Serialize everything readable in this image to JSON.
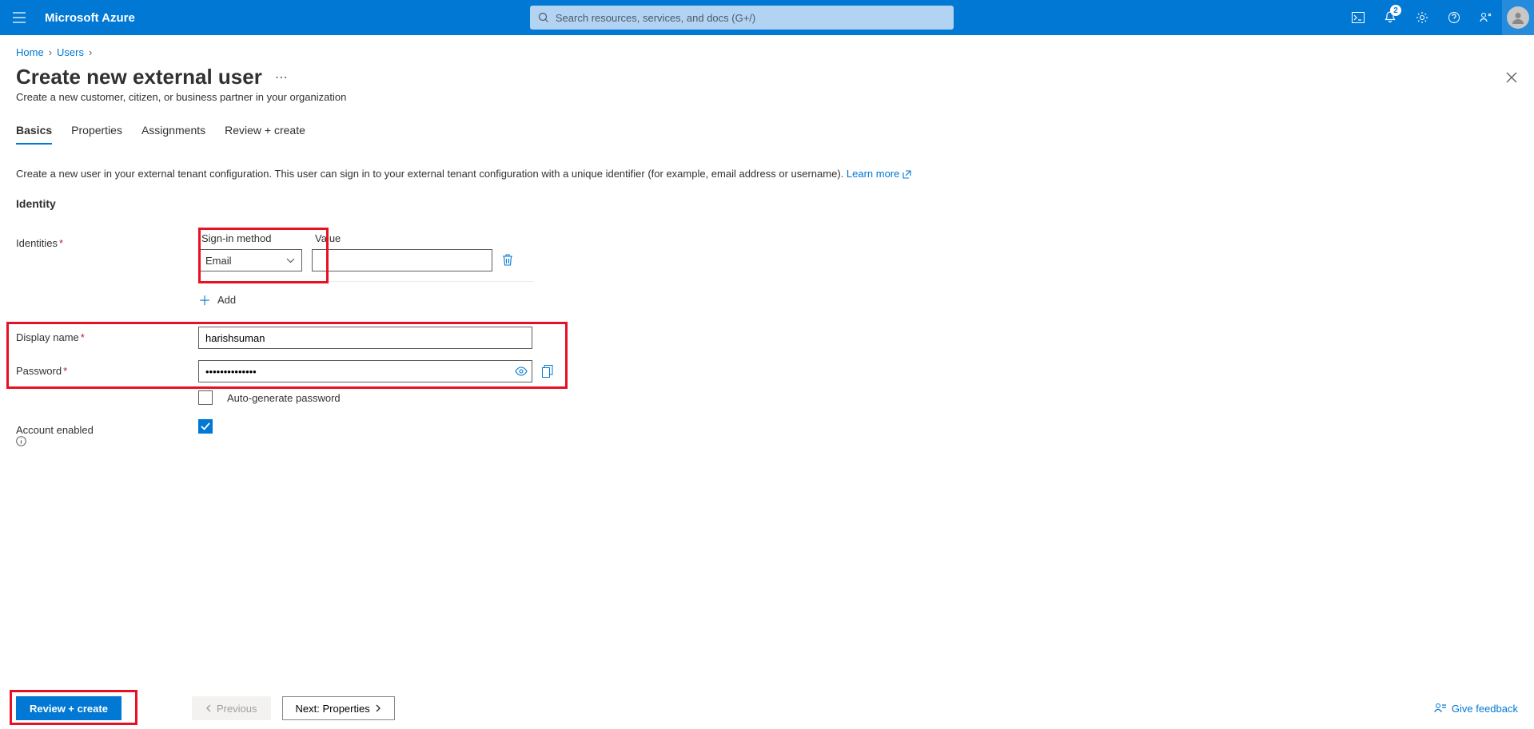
{
  "header": {
    "brand": "Microsoft Azure",
    "search_placeholder": "Search resources, services, and docs (G+/)",
    "notification_badge": "2"
  },
  "breadcrumb": {
    "items": [
      "Home",
      "Users"
    ]
  },
  "page": {
    "title": "Create new external user",
    "subtitle": "Create a new customer, citizen, or business partner in your organization"
  },
  "tabs": [
    "Basics",
    "Properties",
    "Assignments",
    "Review + create"
  ],
  "intro": {
    "text": "Create a new user in your external tenant configuration. This user can sign in to your external tenant configuration with a unique identifier (for example, email address or username). ",
    "link": "Learn more"
  },
  "section": {
    "identity": "Identity"
  },
  "form": {
    "identities_label": "Identities",
    "signin_method_label": "Sign-in method",
    "value_label": "Value",
    "signin_method_value": "Email",
    "value_input": "",
    "add_label": "Add",
    "display_name_label": "Display name",
    "display_name_value": "harishsuman",
    "password_label": "Password",
    "password_value": "••••••••••••••",
    "autogen_label": "Auto-generate password",
    "account_enabled_label": "Account enabled"
  },
  "footer": {
    "review_create": "Review + create",
    "previous": "Previous",
    "next": "Next: Properties",
    "feedback": "Give feedback"
  }
}
